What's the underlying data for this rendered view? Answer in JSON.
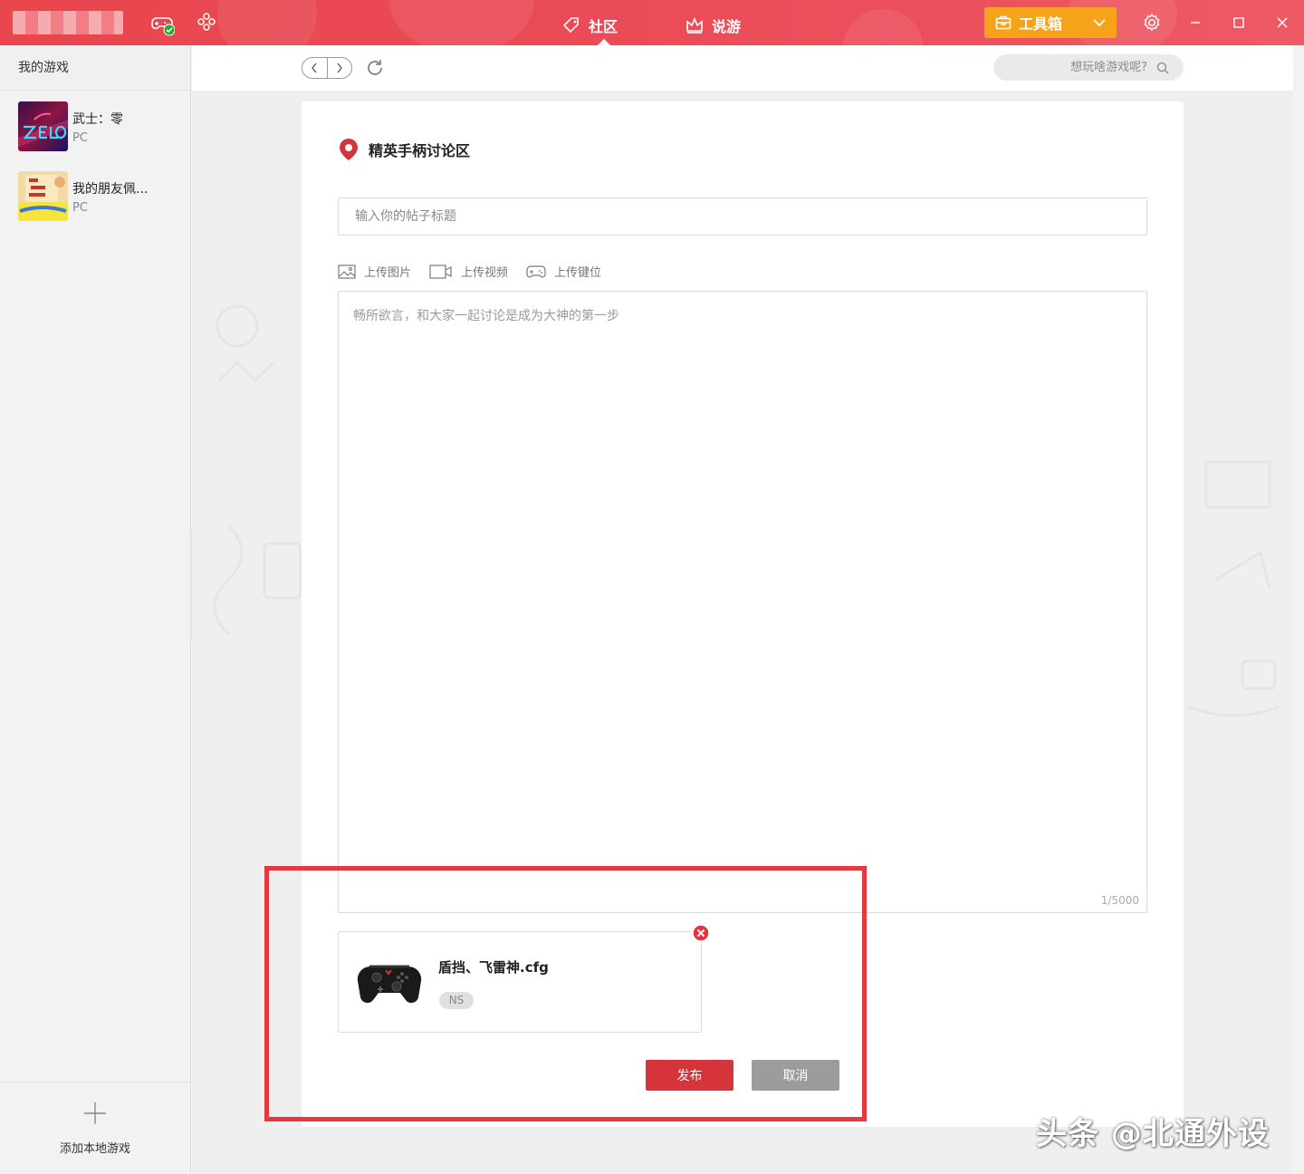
{
  "topbar": {
    "tabs": [
      {
        "label": "社区",
        "icon": "tag-icon",
        "active": true
      },
      {
        "label": "说游",
        "icon": "crown-icon",
        "active": false
      }
    ],
    "toolbox_label": "工具箱",
    "accent_color": "#e9464e",
    "toolbox_color": "#f7a21b"
  },
  "sidebar": {
    "header": "我的游戏",
    "games": [
      {
        "name": "武士：零",
        "platform": "PC"
      },
      {
        "name": "我的朋友佩...",
        "platform": "PC"
      }
    ],
    "add_local_label": "添加本地游戏"
  },
  "navbar": {
    "search_placeholder": "想玩啥游戏呢?"
  },
  "post": {
    "forum_title": "精英手柄讨论区",
    "title_placeholder": "输入你的帖子标题",
    "uploads": [
      "上传图片",
      "上传视频",
      "上传键位"
    ],
    "body_placeholder": "畅所欲言，和大家一起讨论是成为大神的第一步",
    "counter": "1/5000",
    "attachment": {
      "file_name": "盾挡、飞雷神.cfg",
      "platform": "NS"
    },
    "publish_label": "发布",
    "cancel_label": "取消",
    "publish_color": "#d5343b"
  },
  "watermark": "头条 @北通外设"
}
